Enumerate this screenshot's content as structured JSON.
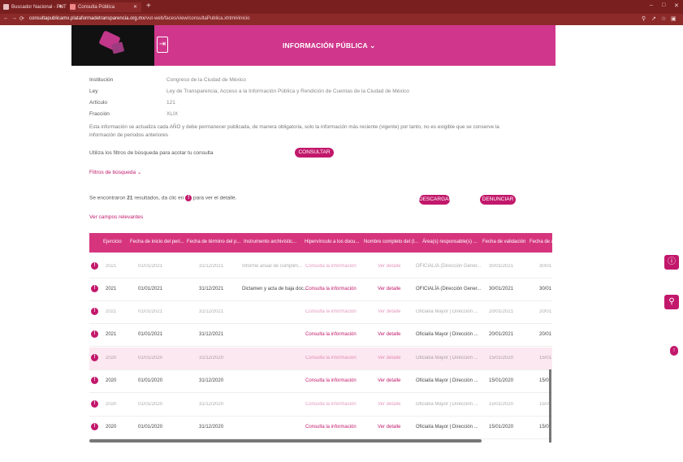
{
  "browser": {
    "tabs": [
      {
        "label": "Buscador Nacional - PNT"
      },
      {
        "label": "Consulta Pública"
      }
    ],
    "url_host": "consultapublicamx.plataformadetransparencia.org.mx",
    "url_path": "/vut-web/faces/view/consultaPublica.xhtml#inicio",
    "new_tab_icon": "plus-icon",
    "colors": {
      "chrome": "#8c2a2a",
      "tabbar": "#7a1f1f"
    }
  },
  "banner": {
    "title": "INFORMACIÓN PÚBLICA ⌄",
    "color": "#d0378c"
  },
  "info": {
    "institucion_label": "Institución",
    "institucion_value": "Congreso de la Ciudad de México",
    "ley_label": "Ley",
    "ley_value": "Ley de Transparencia, Acceso a la Información Pública y Rendición de Cuentas de la Ciudad de México",
    "articulo_label": "Artículo",
    "articulo_value": "121",
    "fraccion_label": "Fracción",
    "fraccion_value": "XLIX",
    "paragraph": "Esta información se actualiza cada AÑO y debe permanecer publicada, de manera obligatoria, solo la información más reciente (vigente) por tanto, no es exigible que se conserve la información de periodos anteriores"
  },
  "filters": {
    "prompt": "Utiliza los filtros de búsqueda para acotar tu consulta",
    "consultar_label": "CONSULTAR",
    "filtros_label": "Filtros de búsqueda ⌄"
  },
  "results": {
    "prefix": "Se encontraron",
    "count": "21",
    "suffix": "resultados, da clic en",
    "suffix2": "para ver el detalle.",
    "descargar_label": "DESCARGAR",
    "denunciar_label": "DENUNCIAR",
    "campos_label": "Ver campos relevantes"
  },
  "table": {
    "headers": [
      "Ejercicio",
      "Fecha de inicio del peri...",
      "Fecha de término del p...",
      "Instrumento archivístic...",
      "Hipervínculo a los docu...",
      "Nombre completo del (l...",
      "Área(s) responsable(s) ...",
      "Fecha de validación",
      "Fecha de a"
    ],
    "rows": [
      {
        "ejercicio": "2021",
        "inicio": "01/01/2021",
        "termino": "31/12/2021",
        "instrumento": "Informe anual de cumplim...",
        "hipervinculo": "Consulta la información",
        "nombre": "Ver detalle",
        "area": "OFICIALÍA (Dirección Gener...",
        "validacion": "30/01/2021",
        "actual": "30/01"
      },
      {
        "ejercicio": "2021",
        "inicio": "01/01/2021",
        "termino": "31/12/2021",
        "instrumento": "Dictamen y acta de baja doc...",
        "hipervinculo": "Consulta la información",
        "nombre": "Ver detalle",
        "area": "OFICIALÍA (Dirección Gener...",
        "validacion": "30/01/2021",
        "actual": "30/01"
      },
      {
        "ejercicio": "2021",
        "inicio": "01/01/2021",
        "termino": "31/12/2021",
        "instrumento": "",
        "hipervinculo": "Consulta la información",
        "nombre": "Ver detalle",
        "area": "Oficialía Mayor | Dirección ...",
        "validacion": "20/01/2021",
        "actual": "20/01"
      },
      {
        "ejercicio": "2021",
        "inicio": "01/01/2021",
        "termino": "31/12/2021",
        "instrumento": "",
        "hipervinculo": "Consulta la información",
        "nombre": "Ver detalle",
        "area": "Oficialía Mayor | Dirección ...",
        "validacion": "20/01/2021",
        "actual": "20/01"
      },
      {
        "ejercicio": "2020",
        "inicio": "01/01/2020",
        "termino": "31/12/2020",
        "instrumento": "",
        "hipervinculo": "Consulta la información",
        "nombre": "Ver detalle",
        "area": "Oficialía Mayor | Dirección ...",
        "validacion": "15/01/2020",
        "actual": "15/01"
      },
      {
        "ejercicio": "2020",
        "inicio": "01/01/2020",
        "termino": "31/12/2020",
        "instrumento": "",
        "hipervinculo": "Consulta la información",
        "nombre": "Ver detalle",
        "area": "Oficialía Mayor | Dirección ...",
        "validacion": "15/01/2020",
        "actual": "15/01"
      },
      {
        "ejercicio": "2020",
        "inicio": "01/01/2020",
        "termino": "31/12/2020",
        "instrumento": "",
        "hipervinculo": "Consulta la información",
        "nombre": "Ver detalle",
        "area": "Oficialía Mayor | Dirección ...",
        "validacion": "15/01/2020",
        "actual": "15/01"
      },
      {
        "ejercicio": "2020",
        "inicio": "01/01/2020",
        "termino": "31/12/2020",
        "instrumento": "",
        "hipervinculo": "Consulta la información",
        "nombre": "Ver detalle",
        "area": "Oficialía Mayor | Dirección ...",
        "validacion": "15/01/2020",
        "actual": "15/01"
      }
    ],
    "accent": "#d6357e"
  },
  "side": {
    "alert_icon": "alert-icon",
    "search_icon": "search-doc-icon",
    "up_icon": "arrow-up-icon"
  }
}
